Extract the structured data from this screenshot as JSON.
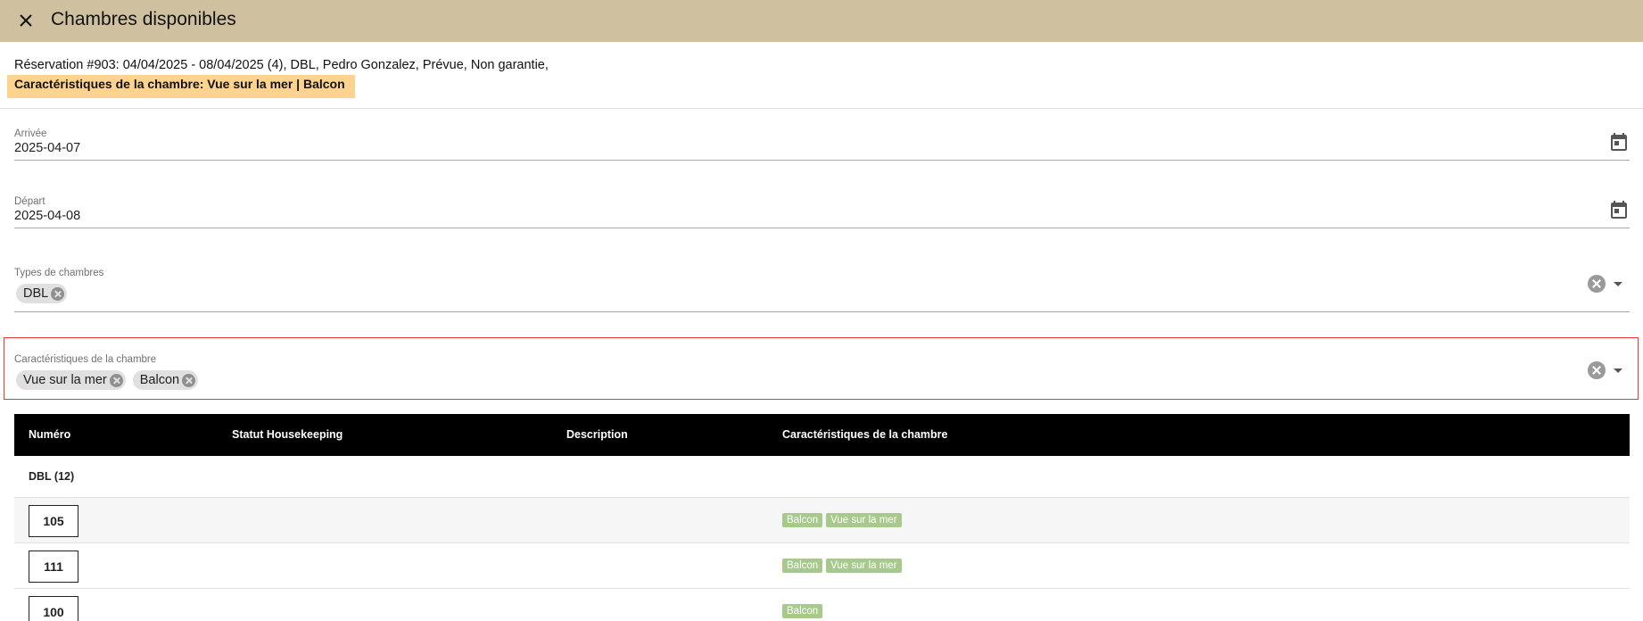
{
  "header": {
    "title": "Chambres disponibles",
    "close_icon": "close-icon",
    "background": "#cfc19f"
  },
  "reservation": {
    "summary": "Réservation #903: 04/04/2025 - 08/04/2025 (4), DBL, Pedro Gonzalez, Prévue, Non garantie,",
    "features": "Caractéristiques de la chambre: Vue sur la mer | Balcon",
    "features_highlight_color": "#fdd38d"
  },
  "form": {
    "arrival": {
      "label": "Arrivée",
      "value": "2025-04-07",
      "icon": "calendar-icon"
    },
    "departure": {
      "label": "Départ",
      "value": "2025-04-08",
      "icon": "calendar-icon"
    },
    "room_types": {
      "label": "Types de chambres",
      "chips": [
        "DBL"
      ]
    },
    "room_features": {
      "label": "Caractéristiques de la chambre",
      "chips": [
        "Vue sur la mer",
        "Balcon"
      ],
      "highlight_color": "#e53935"
    }
  },
  "table": {
    "columns": [
      "Numéro",
      "Statut Housekeeping",
      "Description",
      "Caractéristiques de la chambre"
    ],
    "groups": [
      {
        "label": "DBL (12)",
        "rows": [
          {
            "number": "105",
            "housekeeping": "",
            "description": "",
            "features": [
              "Balcon",
              "Vue sur la mer"
            ]
          },
          {
            "number": "111",
            "housekeeping": "",
            "description": "",
            "features": [
              "Balcon",
              "Vue sur la mer"
            ]
          },
          {
            "number": "100",
            "housekeeping": "",
            "description": "",
            "features": [
              "Balcon"
            ]
          }
        ]
      }
    ],
    "tag_color": "#a8c98c"
  }
}
